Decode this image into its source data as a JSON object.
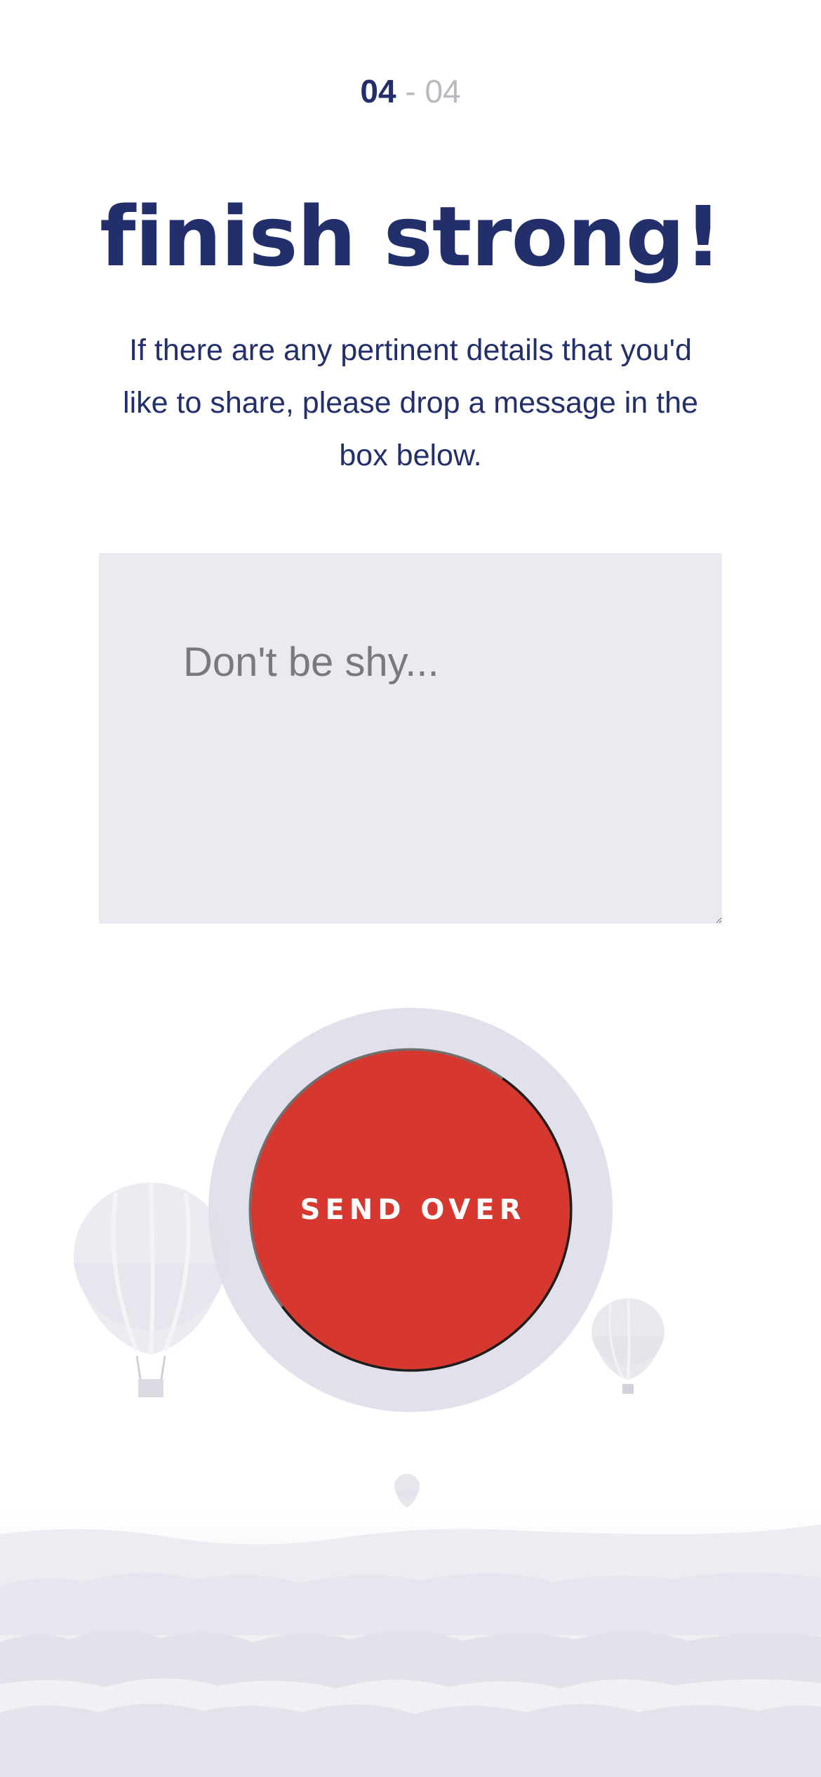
{
  "step": {
    "current": "04",
    "separator": "-",
    "total": "04"
  },
  "headline": "finish strong!",
  "subtitle": "If there are any pertinent details that you'd like to share, please drop a message in the box below.",
  "message": {
    "placeholder": "Don't be shy...",
    "value": ""
  },
  "send_button": {
    "label": "SEND OVER",
    "progress": 0.55
  },
  "colors": {
    "navy": "#232f6b",
    "muted_gray": "#b9b9bf",
    "input_bg": "#eaeaf0",
    "button_red": "#d63830",
    "halo": "#dedee9"
  },
  "icons": {
    "resize": "resize-handle-icon",
    "decor": [
      "hot-air-balloon",
      "misty-landscape"
    ]
  }
}
